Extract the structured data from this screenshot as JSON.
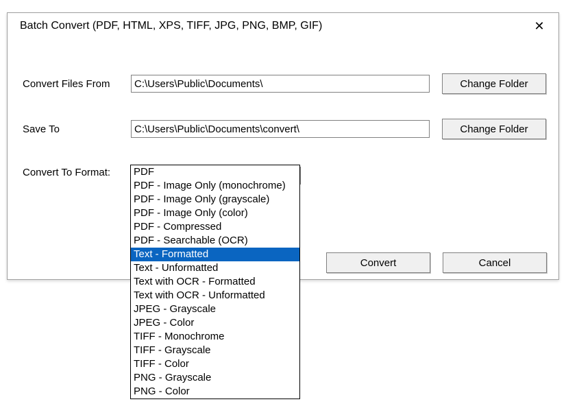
{
  "title": "Batch Convert (PDF, HTML, XPS, TIFF, JPG, PNG, BMP, GIF)",
  "labels": {
    "from": "Convert Files From",
    "saveTo": "Save To",
    "format": "Convert To Format:"
  },
  "inputs": {
    "from": "C:\\Users\\Public\\Documents\\",
    "saveTo": "C:\\Users\\Public\\Documents\\convert\\"
  },
  "buttons": {
    "changeFolder": "Change Folder",
    "convert": "Convert",
    "cancel": "Cancel"
  },
  "combo": {
    "selected": "PDF - Searchable (OCR)"
  },
  "options": [
    "PDF",
    "PDF - Image Only (monochrome)",
    "PDF - Image Only (grayscale)",
    "PDF - Image Only (color)",
    "PDF - Compressed",
    "PDF - Searchable (OCR)",
    "Text - Formatted",
    "Text - Unformatted",
    "Text with OCR - Formatted",
    "Text with OCR - Unformatted",
    "JPEG - Grayscale",
    "JPEG - Color",
    "TIFF - Monochrome",
    "TIFF - Grayscale",
    "TIFF - Color",
    "PNG - Grayscale",
    "PNG - Color"
  ],
  "highlightIndex": 6
}
